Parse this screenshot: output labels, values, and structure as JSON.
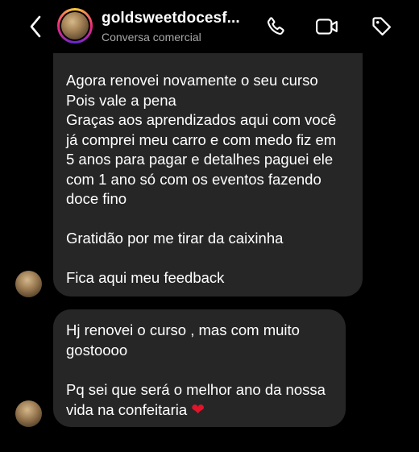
{
  "header": {
    "contact_name": "goldsweetdocesf...",
    "contact_subtitle": "Conversa comercial",
    "icons": {
      "back": "chevron-left-icon",
      "call": "phone-icon",
      "video": "video-camera-icon",
      "tag": "tag-icon"
    }
  },
  "messages": [
    {
      "lines": [
        "Agora renovei novamente o seu curso",
        "Pois vale a pena",
        "Graças aos aprendizados aqui com você",
        "já comprei meu carro e com medo fiz em",
        "5 anos para pagar e detalhes paguei ele",
        "com 1 ano só com os eventos fazendo",
        "doce fino",
        "",
        "Gratidão por me tirar da caixinha",
        "",
        "Fica aqui meu feedback"
      ]
    },
    {
      "lines": [
        "Hj renovei o curso , mas com muito",
        "gostoooo",
        "",
        "Pq sei que será o melhor ano da nossa",
        "vida na confeitaria"
      ],
      "emoji": "❤"
    }
  ],
  "colors": {
    "background": "#000000",
    "bubble": "#262626",
    "subtitle": "#a8a8a8",
    "heart": "#e0142b"
  }
}
